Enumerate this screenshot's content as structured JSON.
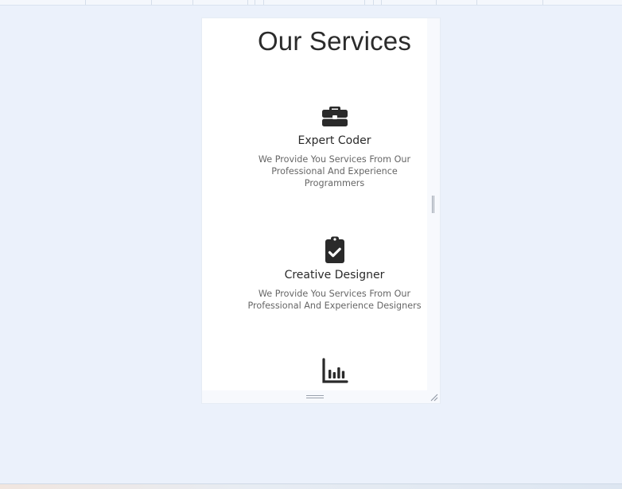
{
  "page": {
    "title": "Our Services"
  },
  "services": [
    {
      "icon": "briefcase-icon",
      "name": "Expert Coder",
      "description": "We Provide You Services From Our Professional And Experience Programmers"
    },
    {
      "icon": "clipboard-check-icon",
      "name": "Creative Designer",
      "description": "We Provide You Services From Our Professional And Experience Designers"
    },
    {
      "icon": "bar-chart-icon",
      "name": "",
      "description": ""
    }
  ],
  "colors": {
    "background": "#ebf1fb",
    "card": "#ffffff",
    "text_dark": "#2a2a2a",
    "text_muted": "#666666"
  }
}
